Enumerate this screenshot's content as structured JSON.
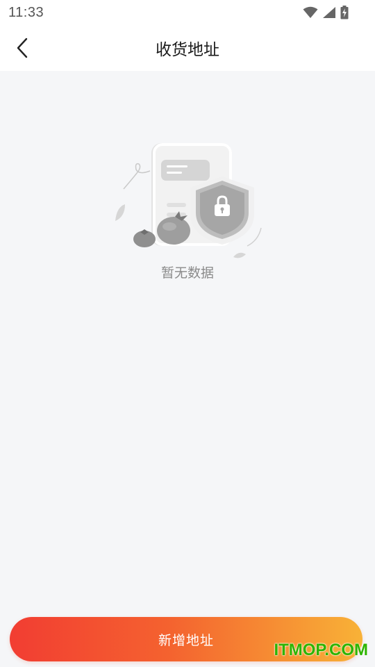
{
  "status_bar": {
    "time": "11:33",
    "icons": [
      "wifi-icon",
      "cell-signal-icon",
      "battery-charging-icon"
    ]
  },
  "header": {
    "back_icon": "chevron-left-icon",
    "title": "收货地址"
  },
  "empty_state": {
    "illustration": "address-security-illustration",
    "text": "暂无数据"
  },
  "footer": {
    "add_button_label": "新增地址"
  },
  "watermark": {
    "text": "ITMOP.COM"
  },
  "colors": {
    "background": "#f5f6f8",
    "button_gradient_start": "#f23d32",
    "button_gradient_end": "#f8b237",
    "watermark": "#2db400"
  }
}
